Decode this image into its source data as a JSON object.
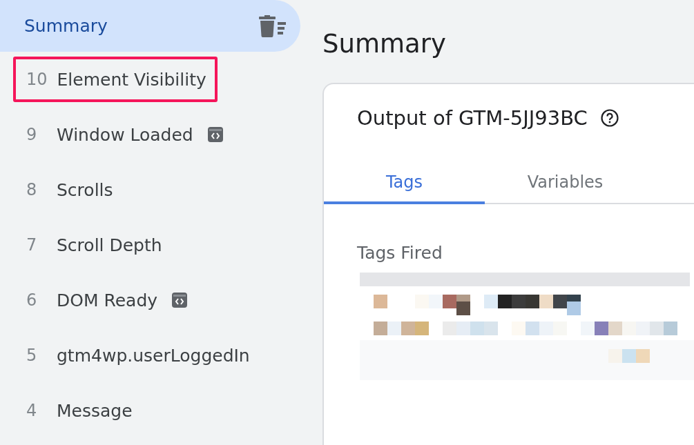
{
  "sidebar": {
    "summary": {
      "label": "Summary",
      "selected": true
    },
    "events": [
      {
        "number": "10",
        "label": "Element Visibility",
        "highlighted": true,
        "code_badge": false
      },
      {
        "number": "9",
        "label": "Window Loaded",
        "highlighted": false,
        "code_badge": true
      },
      {
        "number": "8",
        "label": "Scrolls",
        "highlighted": false,
        "code_badge": false
      },
      {
        "number": "7",
        "label": "Scroll Depth",
        "highlighted": false,
        "code_badge": false
      },
      {
        "number": "6",
        "label": "DOM Ready",
        "highlighted": false,
        "code_badge": true
      },
      {
        "number": "5",
        "label": "gtm4wp.userLoggedIn",
        "highlighted": false,
        "code_badge": false
      },
      {
        "number": "4",
        "label": "Message",
        "highlighted": false,
        "code_badge": false
      }
    ]
  },
  "main": {
    "title": "Summary",
    "card": {
      "title": "Output of GTM-5JJ93BC",
      "tabs": [
        {
          "label": "Tags",
          "selected": true
        },
        {
          "label": "Variables",
          "selected": false
        }
      ],
      "section_title": "Tags Fired"
    }
  }
}
